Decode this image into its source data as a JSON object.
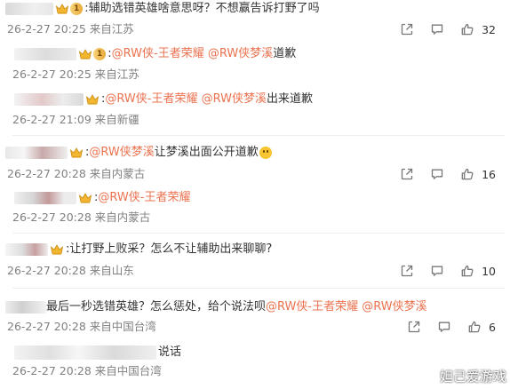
{
  "comments": [
    {
      "text": ":辅助选错英雄啥意思呀？不想赢告诉打野了吗",
      "time": "26-2-27 20:25",
      "location": "来自江苏",
      "likes": "32"
    },
    {
      "prefix": ":",
      "mention1": "@RW侠-王者荣耀",
      "mention2": "@RW侠梦溪",
      "text": " 道歉",
      "time": "26-2-27 20:25",
      "location": "来自江苏"
    },
    {
      "prefix": ":",
      "mention1": "@RW侠-王者荣耀",
      "mention2": "@RW侠梦溪",
      "text": " 出来道歉",
      "time": "26-2-27 21:09",
      "location": "来自新疆"
    },
    {
      "prefix": ":",
      "mention1": "@RW侠梦溪",
      "text": " 让梦溪出面公开道歉",
      "time": "26-2-27 20:28",
      "location": "来自内蒙古",
      "likes": "16"
    },
    {
      "prefix": ":",
      "mention1": "@RW侠-王者荣耀",
      "time": "26-2-27 20:28",
      "location": "来自内蒙古"
    },
    {
      "text": ":让打野上败采？怎么不让辅助出来聊聊?",
      "time": "26-2-27 20:28",
      "location": "来自山东",
      "likes": "10"
    },
    {
      "text": "最后一秒选错英雄？怎么惩处，给个说法呗",
      "mention1": "@RW侠-王者荣耀",
      "mention2": "@RW侠梦溪",
      "time": "26-2-27 20:28",
      "location": "来自中国台湾",
      "likes": "6"
    },
    {
      "text": "说话",
      "time": "26-2-27 20:28",
      "location": "来自中国台湾"
    }
  ],
  "watermark": "妲己爱游戏",
  "colors": {
    "mention": "#eb7350",
    "meta": "#808080",
    "text": "#333333"
  },
  "icons": [
    "share-icon",
    "comment-icon",
    "like-icon",
    "emoji-smile-icon",
    "crown-icon",
    "vip-badge"
  ]
}
